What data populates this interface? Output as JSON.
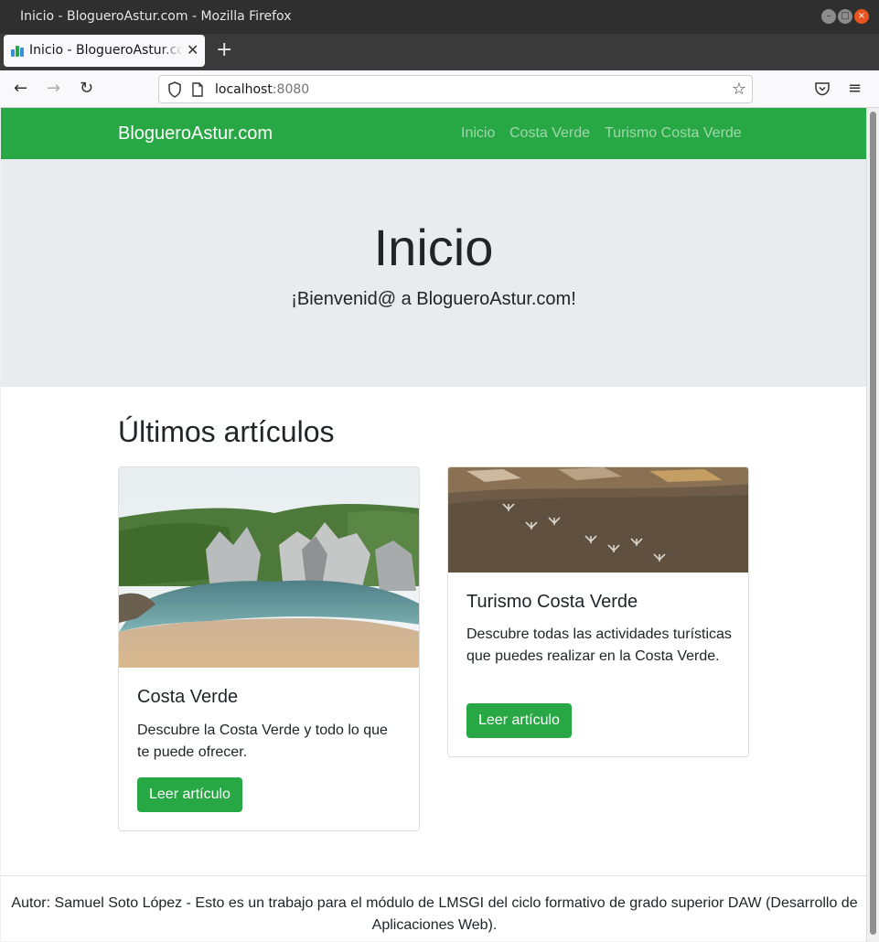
{
  "window": {
    "title": "Inicio - BlogueroAstur.com - Mozilla Firefox"
  },
  "browser": {
    "tab_title": "Inicio - BlogueroAstur.com",
    "url_host": "localhost",
    "url_port": ":8080"
  },
  "site": {
    "brand": "BlogueroAstur.com",
    "nav": [
      "Inicio",
      "Costa Verde",
      "Turismo Costa Verde"
    ]
  },
  "hero": {
    "title": "Inicio",
    "subtitle": "¡Bienvenid@ a BlogueroAstur.com!"
  },
  "articles": {
    "heading": "Últimos artículos",
    "items": [
      {
        "title": "Costa Verde",
        "text": "Descubre la Costa Verde y todo lo que te puede ofrecer.",
        "button": "Leer artículo"
      },
      {
        "title": "Turismo Costa Verde",
        "text": "Descubre todas las actividades turísticas que puedes realizar en la Costa Verde.",
        "button": "Leer artículo"
      }
    ]
  },
  "footer": {
    "text": "Autor: Samuel Soto López - Esto es un trabajo para el módulo de LMSGI del ciclo formativo de grado superior DAW (Desarrollo de Aplicaciones Web)."
  },
  "colors": {
    "brand_green": "#28a745",
    "hero_bg": "#e9ecef"
  }
}
